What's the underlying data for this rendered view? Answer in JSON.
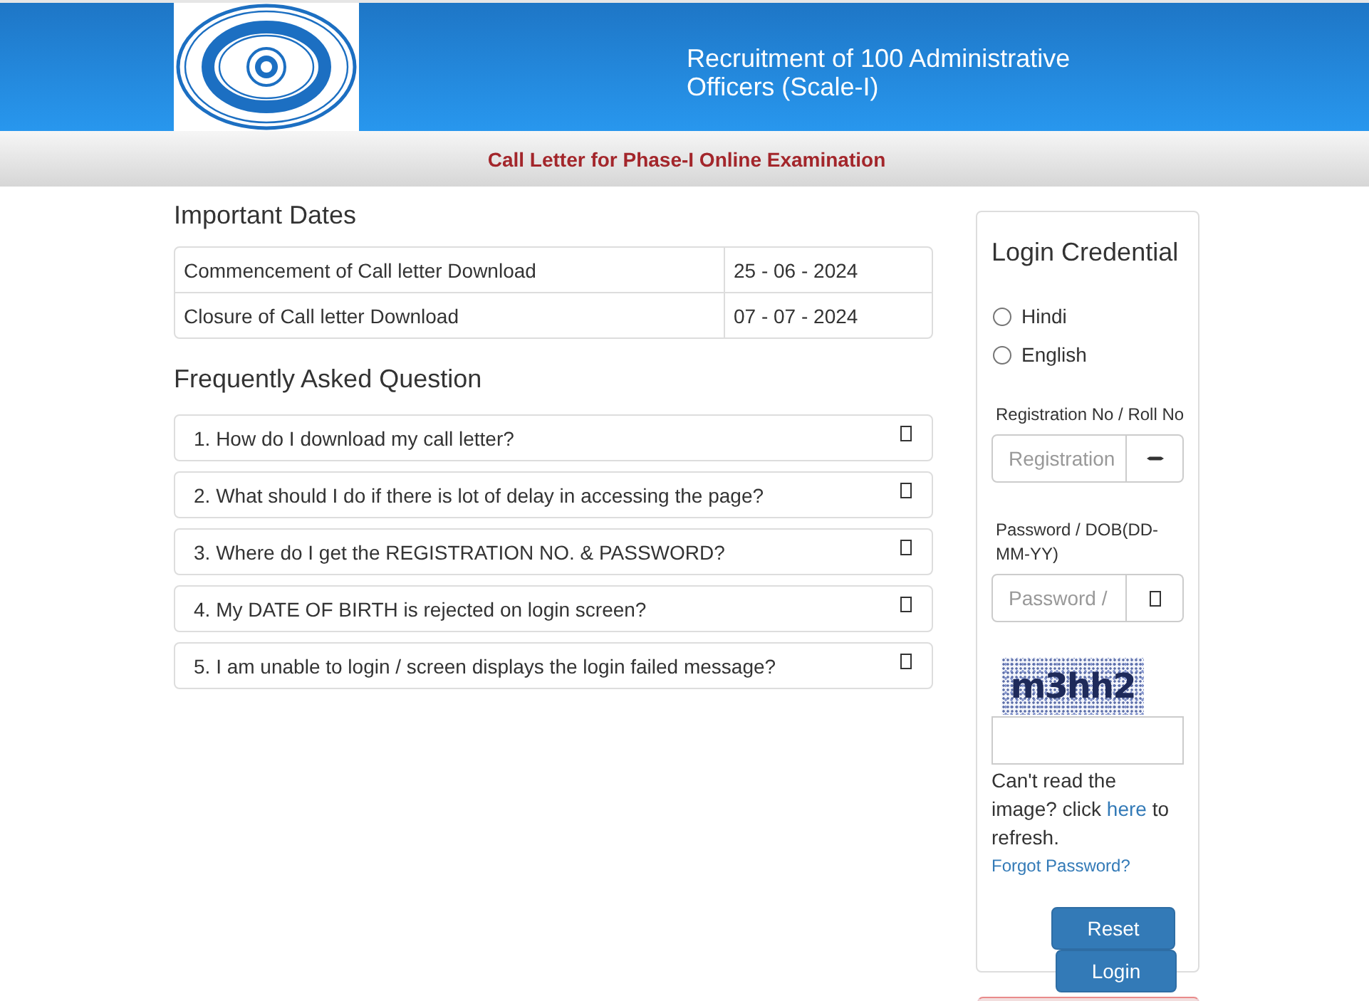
{
  "header": {
    "title": "Recruitment of 100 Administrative Officers (Scale-I)"
  },
  "subheader": {
    "title": "Call Letter for Phase-I Online Examination"
  },
  "important_dates": {
    "heading": "Important Dates",
    "rows": [
      {
        "event": "Commencement of Call letter Download",
        "date": "25 - 06 - 2024"
      },
      {
        "event": "Closure of Call letter Download",
        "date": "07 - 07 - 2024"
      }
    ]
  },
  "faq": {
    "heading": "Frequently Asked Question",
    "items": [
      "1. How do I download my call letter?",
      "2. What should I do if there is lot of delay in accessing the page?",
      "3. Where do I get the REGISTRATION NO. & PASSWORD?",
      "4. My DATE OF BIRTH is rejected on login screen?",
      "5. I am unable to login / screen displays the login failed message?"
    ]
  },
  "login": {
    "heading": "Login Credential",
    "languages": [
      {
        "label": "Hindi",
        "selected": false
      },
      {
        "label": "English",
        "selected": false
      }
    ],
    "registration": {
      "label": "Registration No / Roll No",
      "placeholder": "Registration"
    },
    "password": {
      "label": "Password / DOB(DD-MM-YY)",
      "placeholder": "Password /"
    },
    "captcha": {
      "text": "m3hh2"
    },
    "refresh_note": {
      "before": "Can't read the image? click",
      "link": "here",
      "after": "to refresh."
    },
    "forgot_link": "Forgot Password?",
    "buttons": [
      "Reset",
      "Login"
    ]
  }
}
